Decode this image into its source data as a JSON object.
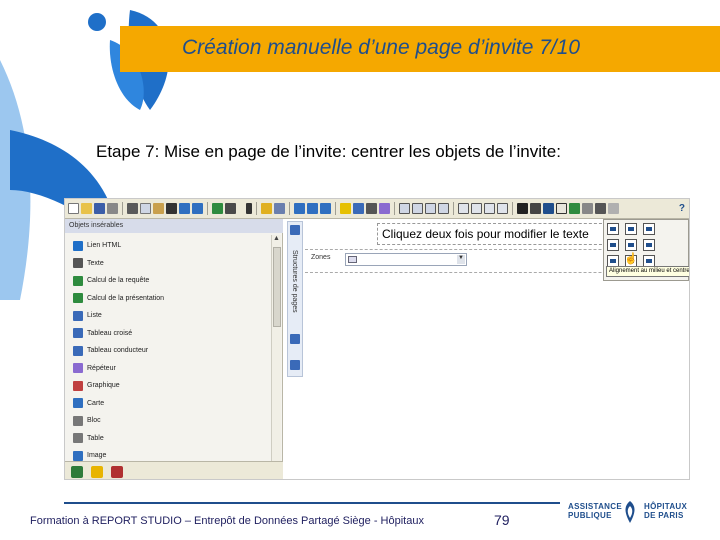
{
  "slide": {
    "title": "Création manuelle d’une page d’invite 7/10",
    "step": "Etape 7: Mise en page de l’invite: centrer les objets de l’invite:",
    "footer_text": "Formation à REPORT STUDIO – Entrepôt de Données Partagé Siège - Hôpitaux",
    "page_number": "79"
  },
  "colors": {
    "title_bar": "#f5a800",
    "title_text": "#1f4e8c",
    "logo_blue": "#1f6fc8",
    "logo_light": "#7fb6ea",
    "footer_navy": "#1f1f5f"
  },
  "screenshot": {
    "panel": {
      "header": "Objets insérables",
      "items": [
        {
          "label": "Lien HTML",
          "icon": "html-link-icon"
        },
        {
          "label": "Texte",
          "icon": "text-icon"
        },
        {
          "label": "Calcul de la requête",
          "icon": "query-calc-icon"
        },
        {
          "label": "Calcul de la présentation",
          "icon": "layout-calc-icon"
        },
        {
          "label": "Liste",
          "icon": "list-icon"
        },
        {
          "label": "Tableau croisé",
          "icon": "crosstab-icon"
        },
        {
          "label": "Tableau conducteur",
          "icon": "driver-table-icon"
        },
        {
          "label": "Répéteur",
          "icon": "repeater-icon"
        },
        {
          "label": "Graphique",
          "icon": "chart-icon"
        },
        {
          "label": "Carte",
          "icon": "map-icon"
        },
        {
          "label": "Bloc",
          "icon": "block-icon"
        },
        {
          "label": "Table",
          "icon": "table-icon"
        },
        {
          "label": "Image",
          "icon": "image-icon"
        }
      ]
    },
    "vstrip_label": "Structures de pages",
    "canvas": {
      "banner": "Cliquez deux fois pour modifier le texte",
      "prompt_label": "Zones"
    },
    "align_popup": {
      "tooltip": "Alignement au milieu et centre"
    },
    "help_glyph": "?"
  },
  "aphp": {
    "left_line1": "ASSISTANCE",
    "left_line2": "PUBLIQUE",
    "right_line1": "HÔPITAUX",
    "right_line2": "DE PARIS"
  }
}
